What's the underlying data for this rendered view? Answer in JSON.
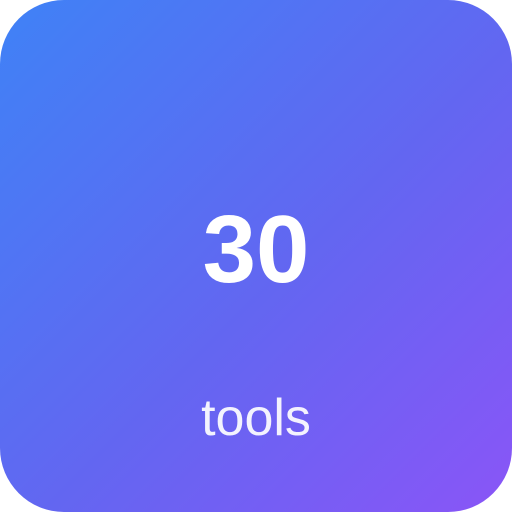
{
  "stat": {
    "value": "30",
    "label": "tools"
  },
  "colors": {
    "gradient_start": "#3f82f6",
    "gradient_mid": "#6366f1",
    "gradient_end": "#8a55f7",
    "text": "#ffffff"
  }
}
